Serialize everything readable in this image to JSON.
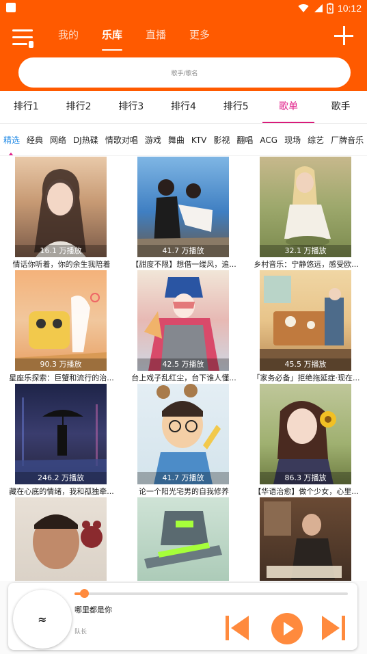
{
  "status_bar": {
    "time": "10:12"
  },
  "header": {
    "tabs": [
      {
        "label": "我的",
        "active": false
      },
      {
        "label": "乐库",
        "active": true
      },
      {
        "label": "直播",
        "active": false
      },
      {
        "label": "更多",
        "active": false
      }
    ],
    "search_placeholder": "歌手/歌名"
  },
  "rank_tabs": [
    "排行1",
    "排行2",
    "排行3",
    "排行4",
    "排行5",
    "歌单",
    "歌手"
  ],
  "rank_tabs_active": 5,
  "categories": [
    "精选",
    "经典",
    "网络",
    "DJ热碟",
    "情歌对唱",
    "游戏",
    "舞曲",
    "KTV",
    "影视",
    "翻唱",
    "ACG",
    "现场",
    "综艺",
    "厂牌音乐"
  ],
  "categories_active": 0,
  "playlists": [
    {
      "plays": "16.1 万播放",
      "title": "情话你听着，你的余生我陪着"
    },
    {
      "plays": "41.7 万播放",
      "title": "【甜度不限】想借一缕风，追..."
    },
    {
      "plays": "32.1 万播放",
      "title": "乡村音乐：宁静悠远，感受欧..."
    },
    {
      "plays": "90.3 万播放",
      "title": "星座乐探索：巨蟹和流行的治..."
    },
    {
      "plays": "42.5 万播放",
      "title": "台上戏子乱红尘，台下谁人懂..."
    },
    {
      "plays": "45.5 万播放",
      "title": "「家务必备」拒绝拖延症·现在..."
    },
    {
      "plays": "246.2 万播放",
      "title": "藏在心底的情绪，我和孤独牵..."
    },
    {
      "plays": "41.7 万播放",
      "title": "论一个阳光宅男的自我修养"
    },
    {
      "plays": "86.3 万播放",
      "title": "【华语治愈】做个少女，心里..."
    },
    {
      "plays": "",
      "title": ""
    },
    {
      "plays": "",
      "title": ""
    },
    {
      "plays": "",
      "title": ""
    }
  ],
  "player": {
    "disc_text": "≈",
    "song": "哪里都是你",
    "artist": "队长",
    "progress": 0.02,
    "accent": "#ff8a3d"
  },
  "colors": {
    "brand": "#ff5a00",
    "active_tab": "#e0208a",
    "active_category": "#1e88e5"
  }
}
